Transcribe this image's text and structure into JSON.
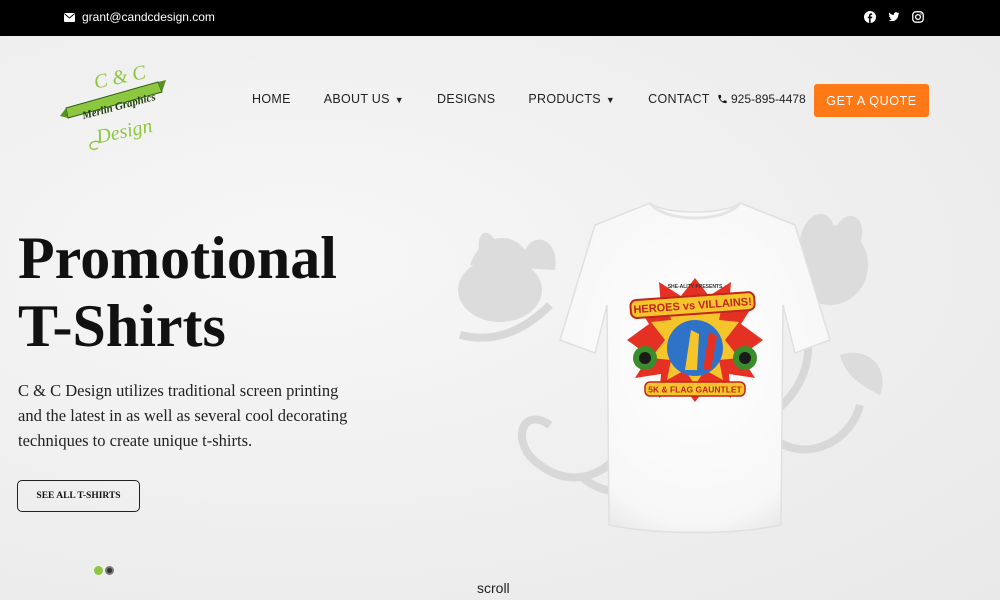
{
  "topbar": {
    "email": "grant@candcdesign.com",
    "social": [
      "facebook-icon",
      "twitter-icon",
      "instagram-icon"
    ]
  },
  "logo": {
    "line1": "C & C",
    "banner": "Merlin Graphics",
    "line2": "Design"
  },
  "nav": {
    "items": [
      {
        "label": "HOME",
        "dropdown": false
      },
      {
        "label": "ABOUT US",
        "dropdown": true
      },
      {
        "label": "DESIGNS",
        "dropdown": false
      },
      {
        "label": "PRODUCTS",
        "dropdown": true
      },
      {
        "label": "CONTACT",
        "dropdown": false
      }
    ],
    "phone": "925-895-4478",
    "cta": "GET A QUOTE"
  },
  "hero": {
    "title_line1": "Promotional",
    "title_line2": "T-Shirts",
    "text": "C & C Design utilizes traditional screen printing and the latest in as well as several cool decorating techniques to create unique t-shirts.",
    "button": "SEE ALL T-SHIRTS",
    "slides": 2,
    "active_slide": 0,
    "scroll_label": "scroll"
  },
  "shirt_graphic": {
    "top_text": "SHE-ALITY PRESENTS",
    "title": "HEROES vs VILLAINS!",
    "bottom_text": "5K & FLAG GAUNTLET"
  },
  "colors": {
    "accent": "#ff7a17",
    "logo_green": "#8dc63f",
    "topbar": "#000000",
    "dot_active": "#8dc63f",
    "dot_inactive": "#333333"
  }
}
